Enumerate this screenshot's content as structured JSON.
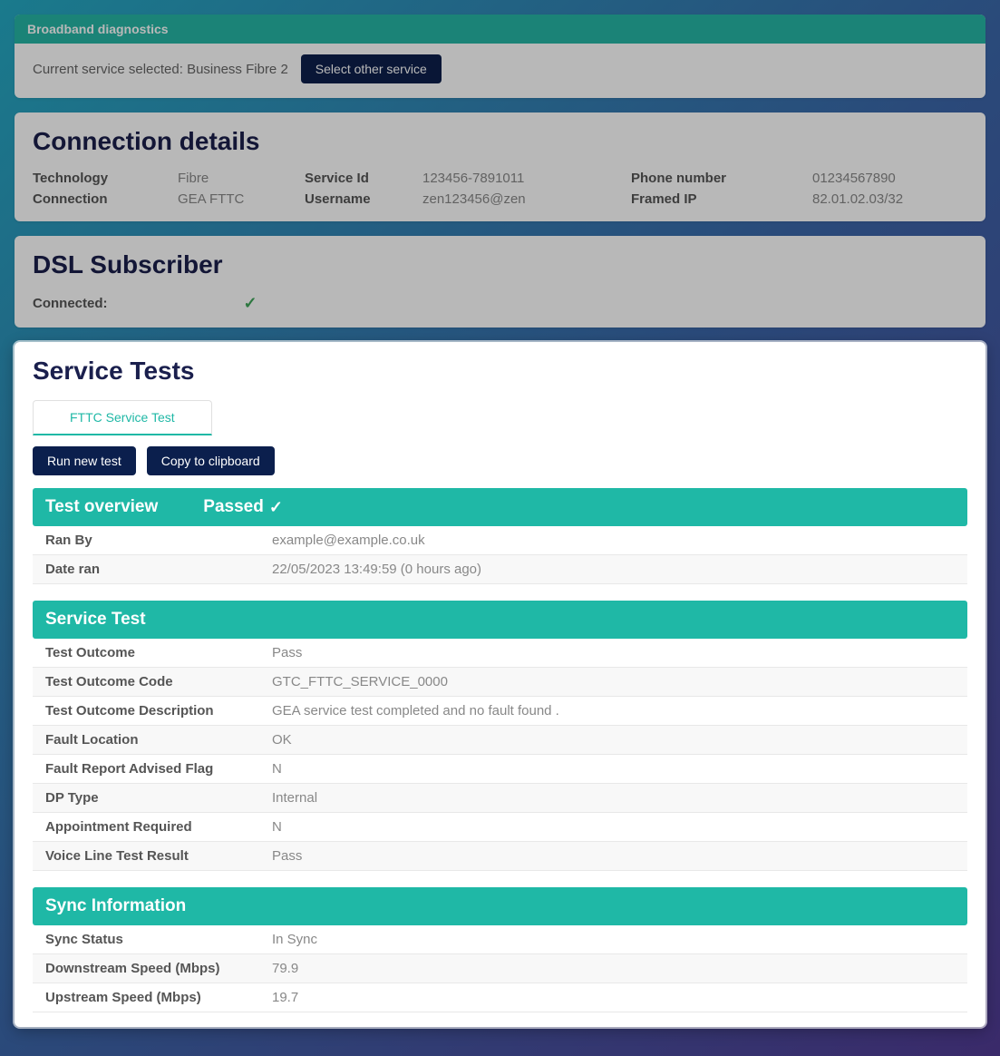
{
  "header": {
    "title": "Broadband diagnostics",
    "current_service_label": "Current service selected: Business Fibre 2",
    "select_other_label": "Select other service"
  },
  "connection_details": {
    "title": "Connection details",
    "rows": [
      {
        "technology_label": "Technology",
        "technology_value": "Fibre",
        "serviceid_label": "Service Id",
        "serviceid_value": "123456-7891011",
        "phone_label": "Phone number",
        "phone_value": "01234567890"
      },
      {
        "connection_label": "Connection",
        "connection_value": "GEA FTTC",
        "username_label": "Username",
        "username_value": "zen123456@zen",
        "framedip_label": "Framed IP",
        "framedip_value": "82.01.02.03/32"
      }
    ]
  },
  "dsl": {
    "title": "DSL Subscriber",
    "connected_label": "Connected:",
    "connected_status": true
  },
  "service_tests": {
    "title": "Service Tests",
    "tab_label": "FTTC Service Test",
    "run_new_label": "Run new test",
    "copy_label": "Copy to clipboard",
    "overview": {
      "title": "Test overview",
      "status_label": "Passed",
      "rows": [
        {
          "label": "Ran By",
          "value": "example@example.co.uk"
        },
        {
          "label": "Date ran",
          "value": "22/05/2023 13:49:59 (0 hours ago)"
        }
      ]
    },
    "service_test": {
      "title": "Service Test",
      "rows": [
        {
          "label": "Test Outcome",
          "value": "Pass"
        },
        {
          "label": "Test Outcome Code",
          "value": "GTC_FTTC_SERVICE_0000"
        },
        {
          "label": "Test Outcome Description",
          "value": "GEA service test completed and no fault found ."
        },
        {
          "label": "Fault Location",
          "value": "OK"
        },
        {
          "label": "Fault Report Advised Flag",
          "value": "N"
        },
        {
          "label": "DP Type",
          "value": "Internal"
        },
        {
          "label": "Appointment Required",
          "value": "N"
        },
        {
          "label": "Voice Line Test Result",
          "value": "Pass"
        }
      ]
    },
    "sync_info": {
      "title": "Sync Information",
      "rows": [
        {
          "label": "Sync Status",
          "value": "In Sync"
        },
        {
          "label": "Downstream Speed (Mbps)",
          "value": "79.9"
        },
        {
          "label": "Upstream Speed (Mbps)",
          "value": "19.7"
        }
      ]
    }
  }
}
